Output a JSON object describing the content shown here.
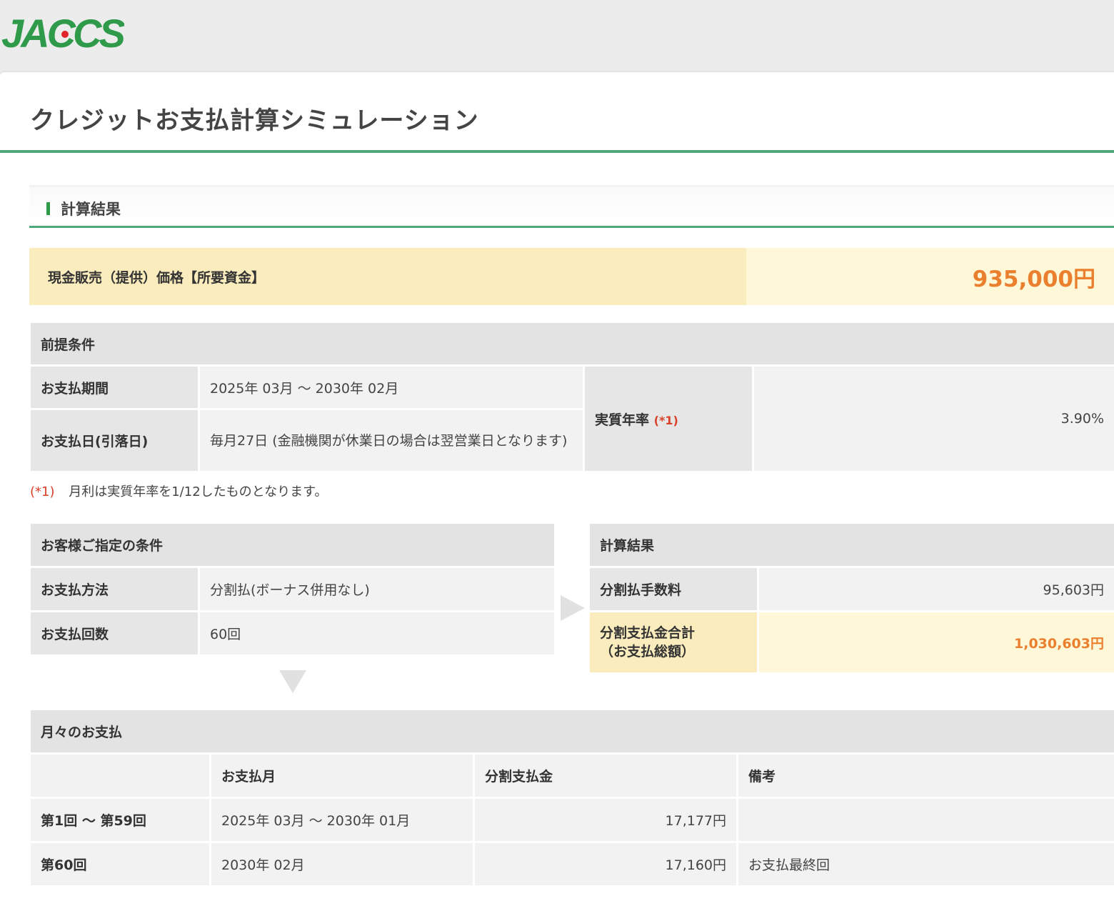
{
  "header": {
    "logo_text": "JACCS",
    "brand_green": "#2f9a4a",
    "brand_red": "#e0262b"
  },
  "page": {
    "title": "クレジットお支払計算シミュレーション"
  },
  "section": {
    "title": "計算結果"
  },
  "price": {
    "label": "現金販売（提供）価格【所要資金】",
    "value": "935,000円"
  },
  "premise": {
    "caption": "前提条件",
    "period_label": "お支払期間",
    "period_value": "2025年 03月 〜 2030年 02月",
    "day_label": "お支払日(引落日)",
    "day_value": "毎月27日 (金融機関が休業日の場合は翌営業日となります)",
    "rate_label": "実質年率",
    "rate_mark": "(*1)",
    "rate_value": "3.90%"
  },
  "footnote": {
    "mark": "(*1)",
    "text": "月利は実質年率を1/12したものとなります。"
  },
  "customer": {
    "caption": "お客様ご指定の条件",
    "method_label": "お支払方法",
    "method_value": "分割払(ボーナス併用なし)",
    "count_label": "お支払回数",
    "count_value": "60回"
  },
  "result": {
    "caption": "計算結果",
    "fee_label": "分割払手数料",
    "fee_value": "95,603円",
    "total_label_1": "分割支払金合計",
    "total_label_2": "（お支払総額）",
    "total_value": "1,030,603円"
  },
  "monthly": {
    "caption": "月々のお支払",
    "columns": [
      "",
      "お支払月",
      "分割支払金",
      "備考"
    ],
    "rows": [
      {
        "term": "第1回 〜 第59回",
        "month": "2025年 03月 〜 2030年 01月",
        "amount": "17,177円",
        "note": ""
      },
      {
        "term": "第60回",
        "month": "2030年 02月",
        "amount": "17,160円",
        "note": "お支払最終回"
      }
    ]
  }
}
